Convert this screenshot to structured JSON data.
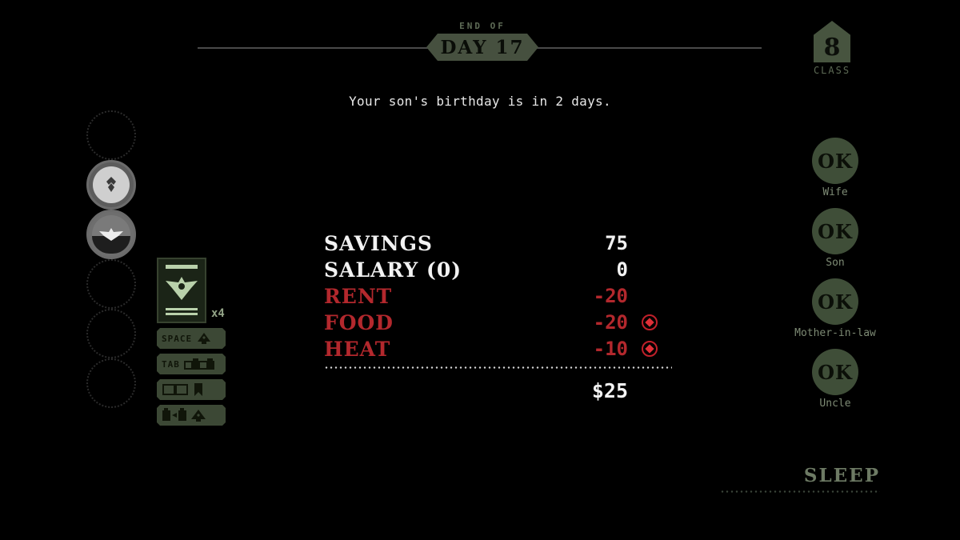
{
  "header": {
    "end_of_label": "END OF",
    "day_label": "DAY 17",
    "class_number": "8",
    "class_caption": "CLASS"
  },
  "message": {
    "text": "Your son's birthday is in 2 days."
  },
  "slots": [
    {
      "name": "slot-1",
      "state": "empty",
      "icon": ""
    },
    {
      "name": "slot-2",
      "state": "filled",
      "icon": "badge-medallion-icon"
    },
    {
      "name": "slot-3",
      "state": "filled",
      "icon": "eagle-emblem-icon"
    },
    {
      "name": "slot-4",
      "state": "empty",
      "icon": ""
    },
    {
      "name": "slot-5",
      "state": "empty",
      "icon": ""
    },
    {
      "name": "slot-6",
      "state": "empty",
      "icon": ""
    }
  ],
  "inventory": {
    "document_count": "x4",
    "document_icon": "passport-eagle-icon",
    "hints": [
      {
        "key": "SPACE",
        "icon": "bell-icon"
      },
      {
        "key": "TAB",
        "icon": "booth-counter-icon"
      },
      {
        "key": "",
        "icon": "rulebook-bookmark-icon"
      },
      {
        "key": "",
        "icon": "document-transfer-bell-icon"
      }
    ]
  },
  "finance": {
    "rows": [
      {
        "label": "SAVINGS",
        "amount": "75",
        "tone": "white",
        "marker": false
      },
      {
        "label": "SALARY (0)",
        "amount": "0",
        "tone": "white",
        "marker": false
      },
      {
        "label": "RENT",
        "amount": "-20",
        "tone": "red",
        "marker": false
      },
      {
        "label": "FOOD",
        "amount": "-20",
        "tone": "red",
        "marker": true
      },
      {
        "label": "HEAT",
        "amount": "-10",
        "tone": "red",
        "marker": true
      }
    ],
    "total": "$25"
  },
  "family": [
    {
      "name": "Wife",
      "status": "OK"
    },
    {
      "name": "Son",
      "status": "OK"
    },
    {
      "name": "Mother-in-law",
      "status": "OK"
    },
    {
      "name": "Uncle",
      "status": "OK"
    }
  ],
  "actions": {
    "sleep_label": "SLEEP"
  },
  "colors": {
    "background": "#000000",
    "accent_green": "#46503f",
    "status_green": "#3f4e38",
    "negative_red": "#b3282d",
    "text_white": "#f2f2f2"
  }
}
